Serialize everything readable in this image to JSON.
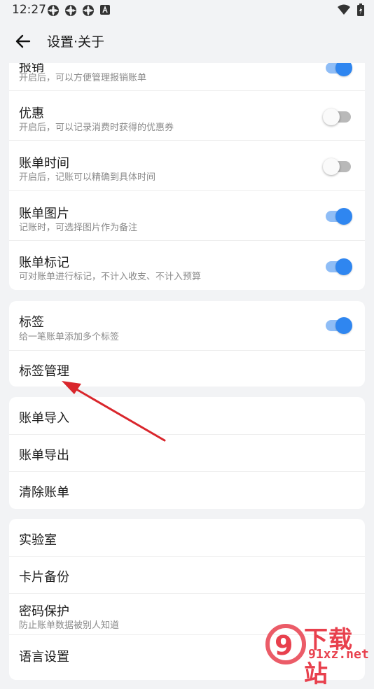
{
  "status_bar": {
    "time": "12:27"
  },
  "header": {
    "title": "设置·关于"
  },
  "card1": {
    "items": [
      {
        "title": "报销",
        "subtitle": "开启后，可以方便管理报销账单",
        "enabled": true
      },
      {
        "title": "优惠",
        "subtitle": "开启后，可以记录消费时获得的优惠券",
        "enabled": false
      },
      {
        "title": "账单时间",
        "subtitle": "开启后，记账可以精确到具体时间",
        "enabled": false
      },
      {
        "title": "账单图片",
        "subtitle": "记账时，可选择图片作为备注",
        "enabled": true
      },
      {
        "title": "账单标记",
        "subtitle": "可对账单进行标记，不计入收支、不计入预算",
        "enabled": true
      }
    ]
  },
  "card2": {
    "tag": {
      "title": "标签",
      "subtitle": "给一笔账单添加多个标签",
      "enabled": true
    },
    "tag_manage": {
      "title": "标签管理"
    }
  },
  "card3": {
    "items": [
      {
        "title": "账单导入"
      },
      {
        "title": "账单导出"
      },
      {
        "title": "清除账单"
      }
    ]
  },
  "card4": {
    "lab": {
      "title": "实验室"
    },
    "backup": {
      "title": "卡片备份"
    },
    "password": {
      "title": "密码保护",
      "subtitle": "防止账单数据被别人知道"
    },
    "language": {
      "title": "语言设置"
    }
  },
  "watermark": {
    "brand": "下载站",
    "url": "91xz.net"
  },
  "colors": {
    "accent": "#2f86f0",
    "background": "#f2f3f5",
    "arrow": "#d9262c",
    "watermark": "#e8404d"
  }
}
